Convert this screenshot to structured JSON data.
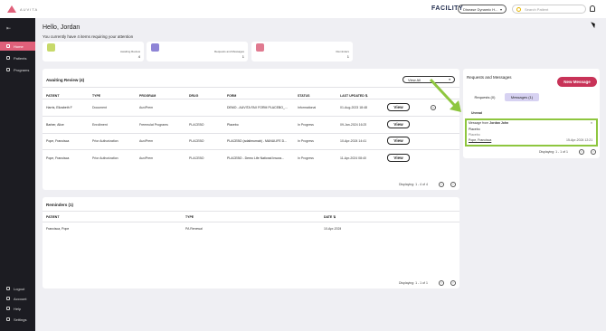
{
  "header": {
    "logo_text": "AUVITA",
    "facility_label": "FACILITY",
    "facility_select": "Disease Dynamic H...",
    "search_placeholder": "Search Patient"
  },
  "sidebar": {
    "items": [
      {
        "label": "Home",
        "active": true
      },
      {
        "label": "Patients",
        "active": false
      },
      {
        "label": "Programs",
        "active": false
      }
    ],
    "bottom_items": [
      {
        "label": "Logout"
      },
      {
        "label": "Account"
      },
      {
        "label": "Help"
      },
      {
        "label": "Settings"
      }
    ]
  },
  "greeting": {
    "title": "Hello, Jordan",
    "subtitle": "You currently have 4 items requiring your attention"
  },
  "stats": [
    {
      "label": "Awaiting Review",
      "value": "4",
      "color": "#c7d96a"
    },
    {
      "label": "Requests and Messages",
      "value": "1",
      "color": "#8e84d6"
    },
    {
      "label": "Reminders",
      "value": "1",
      "color": "#e07a90"
    }
  ],
  "awaiting_review": {
    "title": "Awaiting Review (4)",
    "filter": "View All",
    "columns": [
      "PATIENT",
      "TYPE",
      "PROGRAM",
      "DRUG",
      "FORM",
      "STATUS",
      "LAST UPDATED"
    ],
    "rows": [
      {
        "patient": "Harris, Elizabeth F",
        "type": "Document",
        "program": "AuviPrem",
        "drug": "",
        "form": "DEMO - AUVITA FAX FORM PLACEBO_...",
        "status": "Informational",
        "updated": "01-Aug-2023 18:48",
        "action": "View"
      },
      {
        "patient": "Barber, Alice",
        "type": "Enrollment",
        "program": "Freemulat Programs",
        "drug": "PLACEBO",
        "form": "Placebo",
        "status": "In Progress",
        "updated": "09-Jan-2024 16:25",
        "action": "View"
      },
      {
        "patient": "Pope, Francisca",
        "type": "Prior Authorization",
        "program": "AuviPrem",
        "drug": "PLACEBO",
        "form": "PLACEBO (adalimumab) - MANULIFE D...",
        "status": "In Progress",
        "updated": "10-Apr-2024 14:41",
        "action": "View"
      },
      {
        "patient": "Pope, Francisca",
        "type": "Prior Authorization",
        "program": "AuviPrem",
        "drug": "PLACEBO",
        "form": "PLACEBO - Demo Life National Insura...",
        "status": "In Progress",
        "updated": "11-Apr-2024 08:40",
        "action": "View"
      }
    ],
    "displaying": "Displaying: 1 - 4 of 4"
  },
  "reminders": {
    "title": "Reminders (1)",
    "columns": [
      "PATIENT",
      "TYPE",
      "DATE"
    ],
    "rows": [
      {
        "patient": "Francisca, Pope",
        "type": "PA Renewal",
        "date": "10-Apr-2024"
      }
    ],
    "displaying": "Displaying: 1 - 1 of 1"
  },
  "requests": {
    "title": "Requests and Messages",
    "new_button": "New Message",
    "tabs": [
      {
        "label": "Requests (0)",
        "active": false
      },
      {
        "label": "Messages (1)",
        "active": true
      }
    ],
    "unread_label": "Unread",
    "message": {
      "from_prefix": "Message from",
      "from_name": "Jordan John",
      "subject": "Placebo",
      "body": "Placebo",
      "patient": "Pope, Francisca",
      "timestamp": "15-Apr-2024 12:21"
    },
    "displaying": "Displaying: 1 - 1 of 1"
  },
  "colors": {
    "accent": "#e0607a",
    "sidebar_bg": "#1c1c22",
    "highlight": "#8ec63f",
    "button": "#c83358"
  }
}
